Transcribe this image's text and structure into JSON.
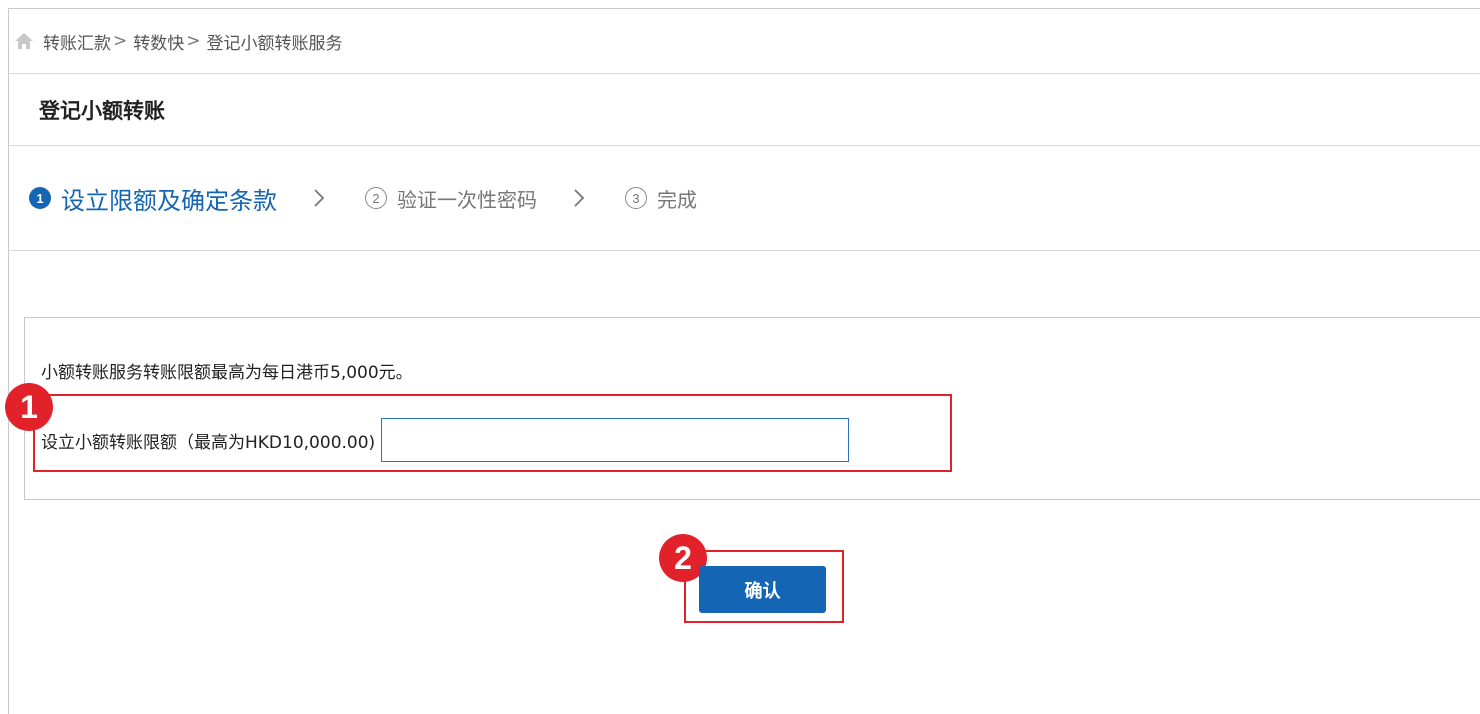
{
  "breadcrumb": {
    "items": [
      "转账汇款",
      "转数快",
      "登记小额转账服务"
    ],
    "separator": ">"
  },
  "page": {
    "title": "登记小额转账"
  },
  "steps": [
    {
      "num": "1",
      "label": "设立限额及确定条款",
      "state": "active"
    },
    {
      "num": "2",
      "label": "验证一次性密码",
      "state": "inactive"
    },
    {
      "num": "3",
      "label": "完成",
      "state": "inactive"
    }
  ],
  "form": {
    "notice": "小额转账服务转账限额最高为每日港币5,000元。",
    "limit_label": "设立小额转账限额（最高为HKD10,000.00)",
    "limit_value": "",
    "limit_placeholder": ""
  },
  "actions": {
    "confirm_label": "确认"
  },
  "annotations": {
    "marker_1": "1",
    "marker_2": "2"
  },
  "colors": {
    "accent": "#1565b5",
    "highlight": "#e2222b"
  },
  "icons": {
    "home": "home-icon",
    "step_arrow": "chevron-right-icon"
  }
}
